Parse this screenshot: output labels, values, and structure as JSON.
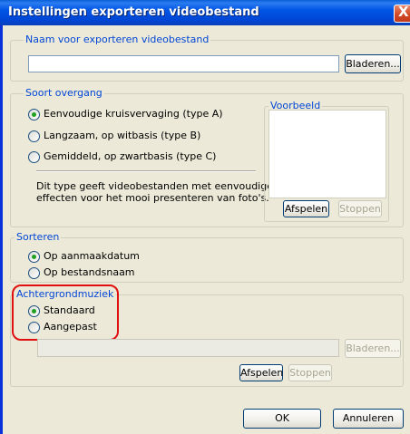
{
  "window": {
    "title": "Instellingen exporteren videobestand",
    "close_glyph": "X"
  },
  "export_name": {
    "legend": "Naam voor exporteren videobestand",
    "value": "",
    "browse_label": "Bladeren..."
  },
  "transition": {
    "legend": "Soort overgang",
    "options": [
      {
        "label": "Eenvoudige kruisvervaging (type A)",
        "selected": true
      },
      {
        "label": "Langzaam, op witbasis (type B)",
        "selected": false
      },
      {
        "label": "Gemiddeld, op zwartbasis (type C)",
        "selected": false
      }
    ],
    "description_lines": [
      "Dit type geeft videobestanden met eenvoudige",
      "effecten voor het mooi presenteren van foto's."
    ]
  },
  "preview": {
    "legend": "Voorbeeld",
    "play_label": "Afspelen",
    "stop_label": "Stoppen"
  },
  "sort": {
    "legend": "Sorteren",
    "options": [
      {
        "label": "Op aanmaakdatum",
        "selected": true
      },
      {
        "label": "Op bestandsnaam",
        "selected": false
      }
    ]
  },
  "music": {
    "legend": "Achtergrondmuziek",
    "options": [
      {
        "label": "Standaard",
        "selected": true
      },
      {
        "label": "Aangepast",
        "selected": false
      }
    ],
    "file_value": "",
    "browse_label": "Bladeren...",
    "play_label": "Afspelen",
    "stop_label": "Stoppen"
  },
  "footer": {
    "ok_label": "OK",
    "cancel_label": "Annuleren"
  },
  "colors": {
    "accent_legend": "#0046d5",
    "highlight": "#e01010",
    "radio_dot": "#21a121"
  }
}
